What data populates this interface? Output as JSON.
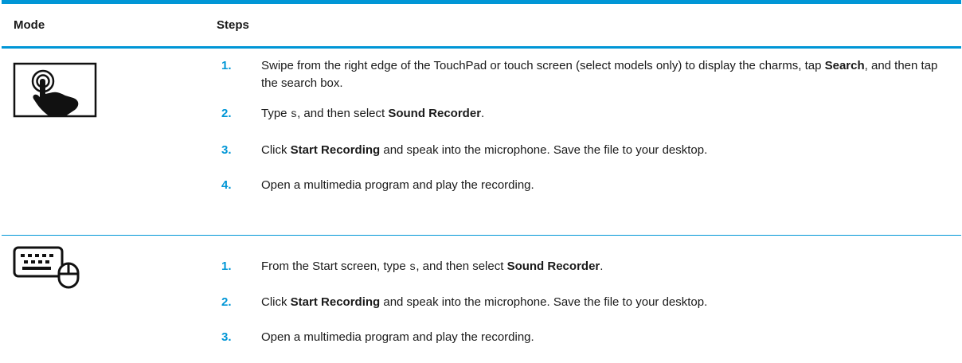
{
  "header": {
    "mode": "Mode",
    "steps": "Steps"
  },
  "rows": [
    {
      "icon": "touch-gesture-icon",
      "steps": [
        {
          "num": "1.",
          "p1": "Swipe from the right edge of the TouchPad or touch screen (select models only) to display the charms, tap ",
          "b1": "Search",
          "p2": ", and then tap the search box."
        },
        {
          "num": "2.",
          "p1": "Type ",
          "code": "s",
          "p2": ", and then select ",
          "b1": "Sound Recorder",
          "p3": "."
        },
        {
          "num": "3.",
          "p1": "Click ",
          "b1": "Start Recording",
          "p2": " and speak into the microphone. Save the file to your desktop."
        },
        {
          "num": "4.",
          "p1": "Open a multimedia program and play the recording."
        }
      ]
    },
    {
      "icon": "keyboard-mouse-icon",
      "steps": [
        {
          "num": "1.",
          "p1": "From the Start screen, type ",
          "code": "s",
          "p2": ", and then select ",
          "b1": "Sound Recorder",
          "p3": "."
        },
        {
          "num": "2.",
          "p1": "Click ",
          "b1": "Start Recording",
          "p2": " and speak into the microphone. Save the file to your desktop."
        },
        {
          "num": "3.",
          "p1": "Open a multimedia program and play the recording."
        }
      ]
    }
  ],
  "colors": {
    "accent": "#0096d6",
    "text": "#1a1a1a"
  }
}
